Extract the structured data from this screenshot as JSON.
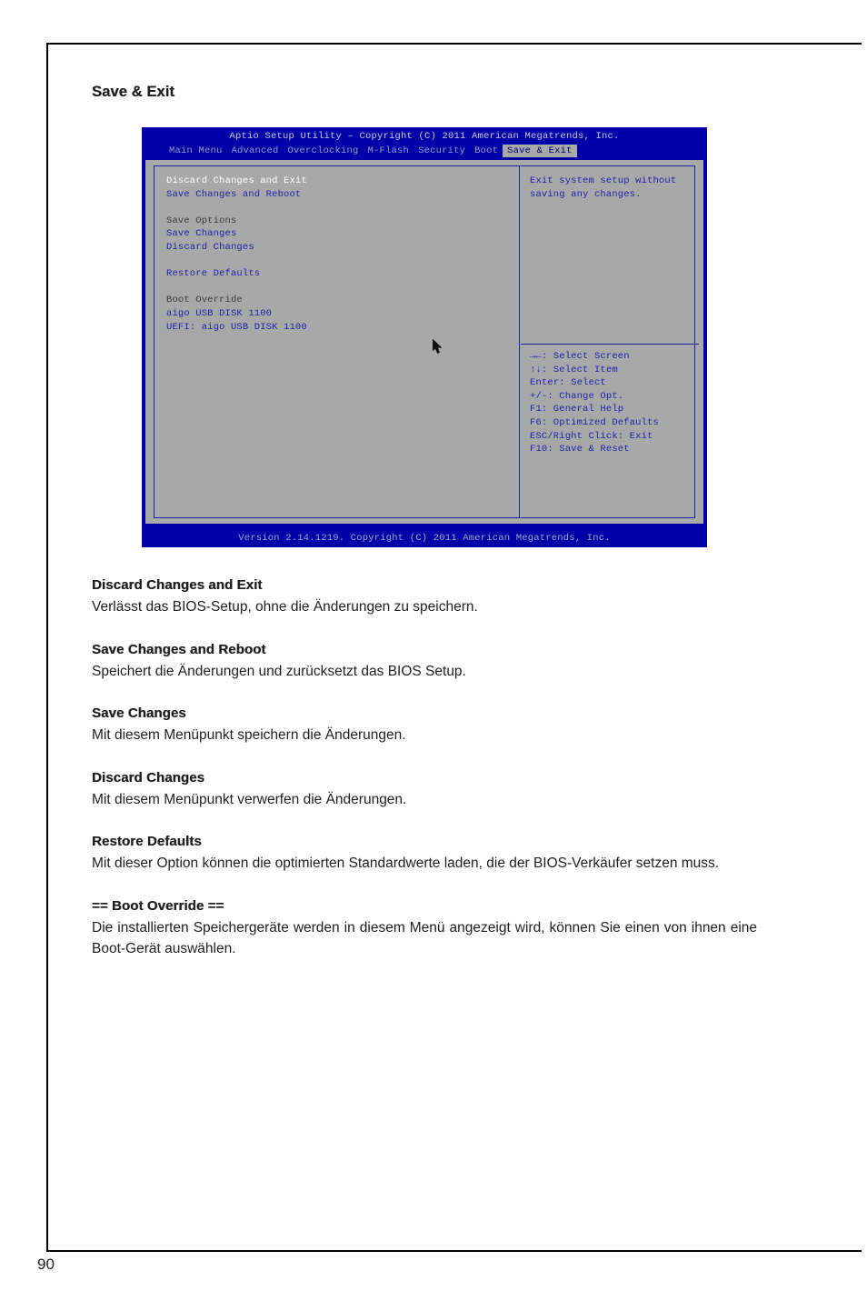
{
  "page": {
    "number": "90",
    "title": "Save & Exit"
  },
  "bios": {
    "titlebar": "Aptio Setup Utility – Copyright (C) 2011 American Megatrends, Inc.",
    "footer": "Version 2.14.1219. Copyright (C) 2011 American Megatrends, Inc.",
    "menu_tabs": [
      {
        "label": "Main Menu",
        "active": false
      },
      {
        "label": "Advanced",
        "active": false
      },
      {
        "label": "Overclocking",
        "active": false
      },
      {
        "label": "M-Flash",
        "active": false
      },
      {
        "label": "Security",
        "active": false
      },
      {
        "label": "Boot",
        "active": false
      },
      {
        "label": "Save & Exit",
        "active": true
      }
    ],
    "left_pane": {
      "items": [
        {
          "text": "Discard Changes and Exit",
          "style": "white"
        },
        {
          "text": "Save Changes and Reboot",
          "style": "link"
        },
        {
          "text": "",
          "style": "spacer"
        },
        {
          "text": "Save Options",
          "style": "label"
        },
        {
          "text": "Save Changes",
          "style": "link"
        },
        {
          "text": "Discard Changes",
          "style": "link"
        },
        {
          "text": "",
          "style": "spacer"
        },
        {
          "text": "Restore Defaults",
          "style": "link"
        },
        {
          "text": "",
          "style": "spacer"
        },
        {
          "text": "Boot Override",
          "style": "label"
        },
        {
          "text": "aigo USB DISK 1100",
          "style": "link"
        },
        {
          "text": "UEFI: aigo USB DISK 1100",
          "style": "link"
        }
      ]
    },
    "right_pane": {
      "help_lines": [
        "Exit system setup without",
        "saving any changes."
      ],
      "key_legend": [
        "→←: Select Screen",
        "↑↓: Select Item",
        "Enter: Select",
        "+/-: Change Opt.",
        "F1: General Help",
        "F6: Optimized Defaults",
        "ESC/Right Click: Exit",
        "F10: Save & Reset"
      ]
    }
  },
  "entries": [
    {
      "heading": "Discard Changes and Exit",
      "body": "Verlässt das BIOS-Setup, ohne die Änderungen zu speichern.",
      "justify": false
    },
    {
      "heading": "Save Changes and Reboot",
      "body": "Speichert die Änderungen und zurücksetzt das BIOS Setup.",
      "justify": false
    },
    {
      "heading": "Save Changes",
      "body": "Mit diesem Menüpunkt speichern die Änderungen.",
      "justify": false
    },
    {
      "heading": "Discard Changes",
      "body": "Mit diesem Menüpunkt verwerfen die Änderungen.",
      "justify": false
    },
    {
      "heading": "Restore Defaults",
      "body": "Mit dieser Option können die optimierten Standardwerte laden, die der BIOS-Verkäufer setzen muss.",
      "justify": true
    },
    {
      "heading": "== Boot Override ==",
      "body": "Die installierten Speichergeräte werden in diesem Menü angezeigt wird, können Sie einen von ihnen eine Boot-Gerät auswählen.",
      "justify": true
    }
  ]
}
